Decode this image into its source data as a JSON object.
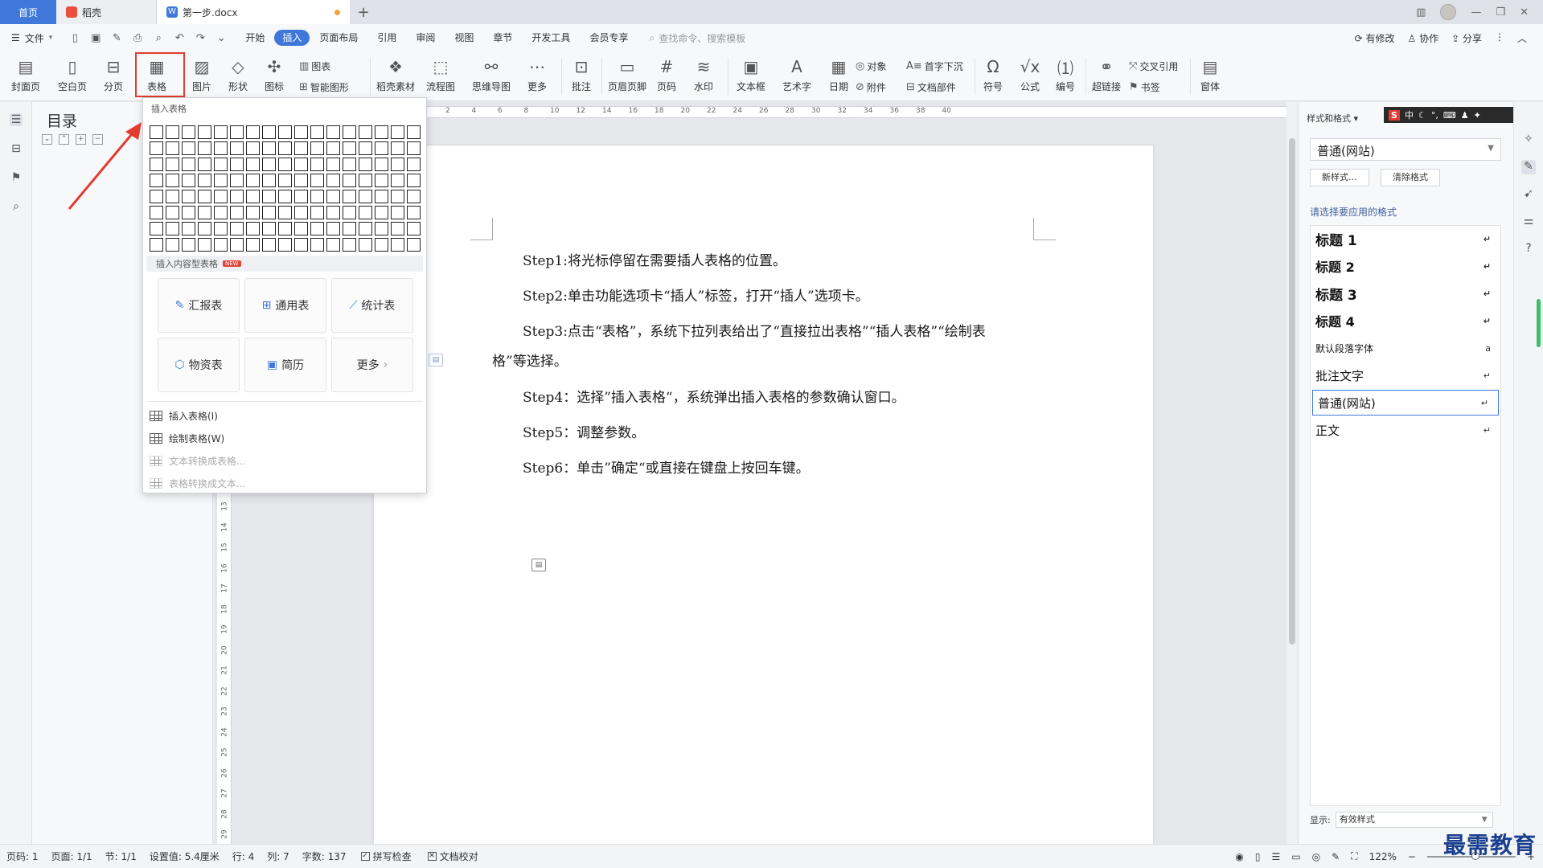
{
  "tabs": {
    "home": "首页",
    "daoke": "稻壳",
    "doc": "第一步.docx"
  },
  "menu": {
    "file": "文件",
    "tabs": [
      "开始",
      "插入",
      "页面布局",
      "引用",
      "审阅",
      "视图",
      "章节",
      "开发工具",
      "会员专享"
    ],
    "active_tab": "插入",
    "search_placeholder": "查找命令、搜索模板",
    "right": {
      "revise": "有修改",
      "collab": "协作",
      "share": "分享"
    }
  },
  "ribbon": {
    "cover": "封面页",
    "blank": "空白页",
    "pagebreak": "分页",
    "table": "表格",
    "picture": "图片",
    "shape": "形状",
    "icon": "图标",
    "chart": "图表",
    "smartart": "智能图形",
    "daoke_material": "稻壳素材",
    "flowchart": "流程图",
    "mindmap": "思维导图",
    "more": "更多",
    "comment": "批注",
    "header_footer": "页眉页脚",
    "page_number": "页码",
    "watermark": "水印",
    "textbox": "文本框",
    "wordart": "艺术字",
    "date": "日期",
    "object": "对象",
    "attachment": "附件",
    "dropcap": "首字下沉",
    "doc_parts": "文档部件",
    "symbol": "符号",
    "formula": "公式",
    "numbering": "编号",
    "hyperlink": "超链接",
    "crossref": "交叉引用",
    "bookmark": "书签",
    "window": "窗体"
  },
  "nav": {
    "title": "目录"
  },
  "dropdown": {
    "header": "插入表格",
    "grid_cols": 17,
    "grid_rows": 8,
    "content_header": "插入内容型表格",
    "new_badge": "NEW",
    "cards": [
      "汇报表",
      "通用表",
      "统计表",
      "物资表",
      "简历",
      "更多"
    ],
    "items": [
      {
        "label": "插入表格(I)",
        "enabled": true
      },
      {
        "label": "绘制表格(W)",
        "enabled": true
      },
      {
        "label": "文本转换成表格...",
        "enabled": false
      },
      {
        "label": "表格转换成文本...",
        "enabled": false
      }
    ]
  },
  "document": {
    "paragraphs": [
      "Step1:将光标停留在需要插人表格的位置。",
      "Step2:单击功能选项卡“插人”标签，打开“插人”选项卡。",
      "Step3:点击“表格”，系统下拉列表给出了“直接拉出表格”“插人表格”“绘制表",
      "格”等选择。",
      "Step4：选择”插入表格“，系统弹出插入表格的参数确认窗口。",
      "Step5：调整参数。",
      "Step6：单击”确定“或直接在键盘上按回车键。"
    ]
  },
  "ruler": {
    "h_numbers": [
      "2",
      "4",
      "6",
      "8",
      "10",
      "12",
      "14",
      "16",
      "18",
      "20",
      "22",
      "24",
      "26",
      "28",
      "30",
      "32",
      "34",
      "36",
      "38",
      "40"
    ],
    "v_numbers": [
      "13",
      "14",
      "15",
      "16",
      "17",
      "18",
      "19",
      "20",
      "21",
      "22",
      "23",
      "24",
      "25",
      "26",
      "27",
      "28",
      "29"
    ]
  },
  "right_panel": {
    "title": "样式和格式",
    "current_style": "普通(网站)",
    "new_style": "新样式...",
    "clear_format": "清除格式",
    "subtitle": "请选择要应用的格式",
    "styles": [
      "标题 1",
      "标题 2",
      "标题 3",
      "标题 4",
      "默认段落字体",
      "批注文字",
      "普通(网站)",
      "正文"
    ],
    "selected_style": "普通(网站)",
    "show_label": "显示:",
    "show_value": "有效样式",
    "ime": {
      "s": "S",
      "text": "中"
    }
  },
  "statusbar": {
    "page_code": "页码: 1",
    "pages": "页面: 1/1",
    "section": "节: 1/1",
    "setting": "设置值: 5.4厘米",
    "row": "行: 4",
    "col": "列: 7",
    "words": "字数: 137",
    "spellcheck": "拼写检查",
    "doc_check": "文档校对",
    "zoom": "122%",
    "zoom_level": 0.55
  },
  "watermark": "最需教育"
}
